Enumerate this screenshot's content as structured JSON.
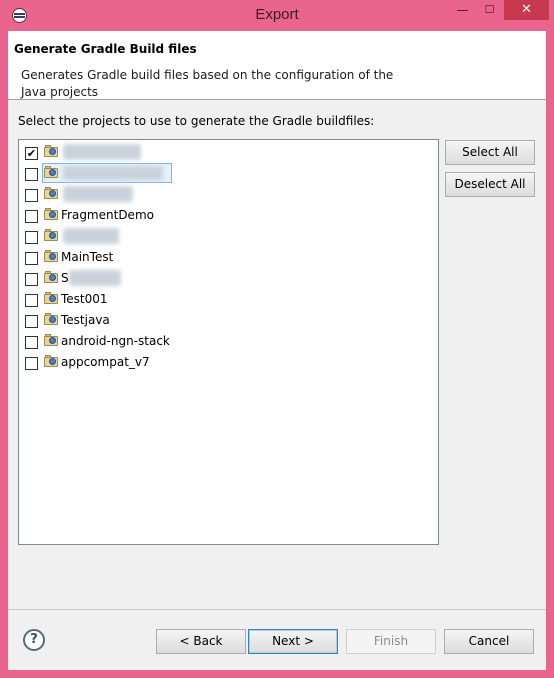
{
  "window": {
    "title": "Export"
  },
  "title_buttons": {
    "minimize": "—",
    "maximize": "☐",
    "close": "✕"
  },
  "header": {
    "title": "Generate Gradle Build files",
    "description": "Generates Gradle build files based on the configuration of the Java projects"
  },
  "prompt": "Select the projects to use to generate the Gradle buildfiles:",
  "projects": [
    {
      "label": "",
      "checked": true
    },
    {
      "label": "",
      "checked": false
    },
    {
      "label": "",
      "checked": false
    },
    {
      "label": "FragmentDemo",
      "checked": false
    },
    {
      "label": "",
      "checked": false
    },
    {
      "label": "MainTest",
      "checked": false
    },
    {
      "label": "S",
      "checked": false
    },
    {
      "label": "Test001",
      "checked": false
    },
    {
      "label": "Testjava",
      "checked": false
    },
    {
      "label": "android-ngn-stack",
      "checked": false
    },
    {
      "label": "appcompat_v7",
      "checked": false
    }
  ],
  "side_buttons": {
    "select_all": "Select All",
    "deselect_all": "Deselect All"
  },
  "footer": {
    "help_icon": "?",
    "back": "< Back",
    "next": "Next >",
    "finish": "Finish",
    "cancel": "Cancel"
  },
  "check_mark": "✔"
}
